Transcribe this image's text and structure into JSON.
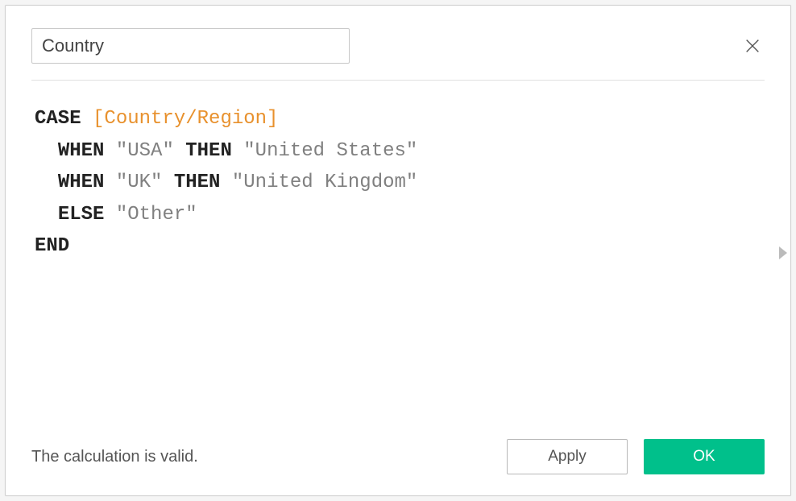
{
  "field_name": "Country",
  "formula": {
    "tokens": [
      {
        "t": "kw",
        "v": "CASE "
      },
      {
        "t": "field",
        "v": "[Country/Region]"
      },
      {
        "t": "nl",
        "v": "\n"
      },
      {
        "t": "plain",
        "v": "  "
      },
      {
        "t": "kw",
        "v": "WHEN "
      },
      {
        "t": "str",
        "v": "\"USA\" "
      },
      {
        "t": "kw",
        "v": "THEN "
      },
      {
        "t": "str",
        "v": "\"United States\""
      },
      {
        "t": "nl",
        "v": "\n"
      },
      {
        "t": "plain",
        "v": "  "
      },
      {
        "t": "kw",
        "v": "WHEN "
      },
      {
        "t": "str",
        "v": "\"UK\" "
      },
      {
        "t": "kw",
        "v": "THEN "
      },
      {
        "t": "str",
        "v": "\"United Kingdom\""
      },
      {
        "t": "nl",
        "v": "\n"
      },
      {
        "t": "plain",
        "v": "  "
      },
      {
        "t": "kw",
        "v": "ELSE "
      },
      {
        "t": "str",
        "v": "\"Other\""
      },
      {
        "t": "nl",
        "v": "\n"
      },
      {
        "t": "kw",
        "v": "END"
      }
    ]
  },
  "status_text": "The calculation is valid.",
  "buttons": {
    "apply": "Apply",
    "ok": "OK"
  }
}
